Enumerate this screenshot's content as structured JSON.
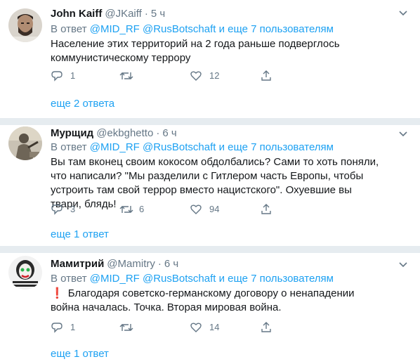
{
  "tweets": [
    {
      "name": "John Kaiff",
      "handle": "@JKaiff",
      "time": "5 ч",
      "reply_prefix": "В ответ",
      "reply_users": "@MID_RF @RusBotschaft",
      "reply_suffix": "и еще 7 пользователям",
      "text": "Население этих территорий на 2 года раньше подверглось коммунистическому террору",
      "replies": "1",
      "retweets": "",
      "likes": "12",
      "more": "еще 2 ответа"
    },
    {
      "name": "Мурщид",
      "handle": "@ekbghetto",
      "time": "6 ч",
      "reply_prefix": "В ответ",
      "reply_users": "@MID_RF @RusBotschaft",
      "reply_suffix": "и еще 7 пользователям",
      "text": "Вы там вконец своим кокосом обдолбались? Сами то хоть поняли, что написали? \"Мы разделили с Гитлером часть Европы, чтобы устроить там свой террор вместо нацистского\". Охуевшие вы твари, блядь!",
      "replies": "3",
      "retweets": "6",
      "likes": "94",
      "more": "еще 1 ответ"
    },
    {
      "name": "Мамитрий",
      "handle": "@Mamitry",
      "time": "6 ч",
      "reply_prefix": "В ответ",
      "reply_users": "@MID_RF @RusBotschaft",
      "reply_suffix": "и еще 7 пользователям",
      "exclamation": "❗",
      "text": "Благодаря советско-германскому договору о ненападении война началась. Точка. Вторая мировая война.",
      "replies": "1",
      "retweets": "",
      "likes": "14",
      "more": "еще 1 ответ"
    }
  ],
  "colors": {
    "accent": "#1da1f2",
    "muted": "#657786",
    "text": "#14171a",
    "divider": "#e6ecf0"
  },
  "icons": [
    "reply-icon",
    "retweet-icon",
    "like-icon",
    "share-icon",
    "chevron-down-icon",
    "avatar"
  ]
}
